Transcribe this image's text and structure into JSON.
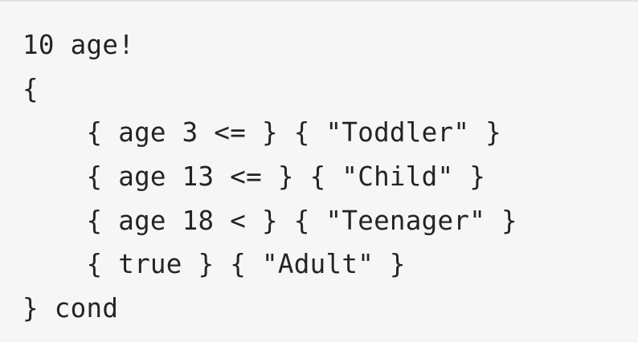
{
  "code": {
    "lines": [
      "10 age!",
      "{",
      "    { age 3 <= } { \"Toddler\" }",
      "    { age 13 <= } { \"Child\" }",
      "    { age 18 < } { \"Teenager\" }",
      "    { true } { \"Adult\" }",
      "} cond"
    ]
  }
}
